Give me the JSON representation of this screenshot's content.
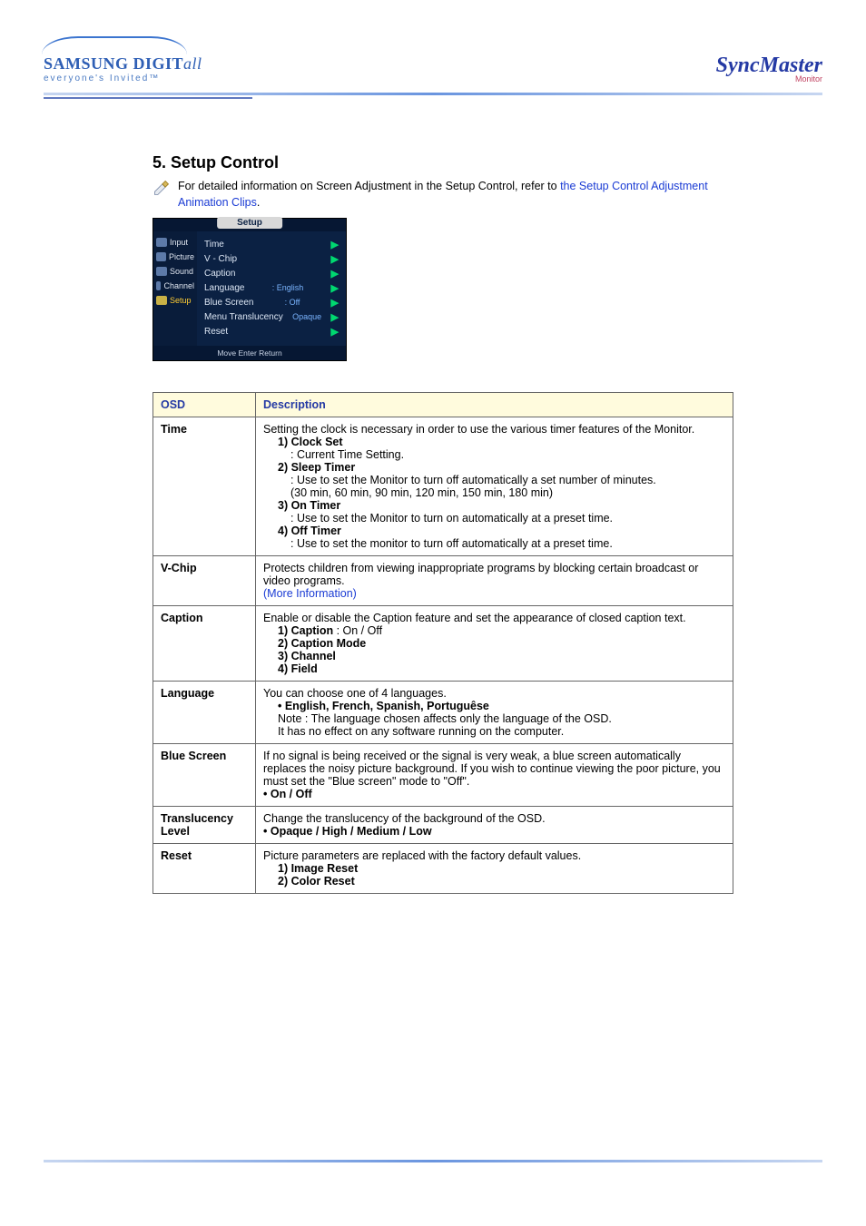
{
  "brand": {
    "left_main_bold": "SAMSUNG DIGIT",
    "left_main_ital": "all",
    "left_tagline": "everyone's Invited™",
    "right_main": "SyncMaster",
    "right_sub": "Monitor"
  },
  "section": {
    "title": "5. Setup Control",
    "info_prefix": "For detailed information on Screen Adjustment in the Setup Control, refer to ",
    "info_link": "the Setup Control Adjustment Animation Clips",
    "info_suffix": "."
  },
  "osd_mock": {
    "title": "Setup",
    "side": [
      "Input",
      "Picture",
      "Sound",
      "Channel",
      "Setup"
    ],
    "side_selected": 4,
    "rows": [
      {
        "label": "Time",
        "val": ""
      },
      {
        "label": "V - Chip",
        "val": ""
      },
      {
        "label": "Caption",
        "val": ""
      },
      {
        "label": "Language",
        "val": ": English"
      },
      {
        "label": "Blue Screen",
        "val": ": Off"
      },
      {
        "label": "Menu Translucency",
        "val": "Opaque"
      },
      {
        "label": "Reset",
        "val": ""
      }
    ],
    "footer": "Move    Enter    Return"
  },
  "table": {
    "headers": [
      "OSD",
      "Description"
    ],
    "rows": {
      "time": {
        "osd": "Time",
        "intro": "Setting the clock is necessary in order to use the various timer features of the Monitor.",
        "l1": "1) Clock Set",
        "l1a": ": Current Time Setting.",
        "l2": "2) Sleep Timer",
        "l2a": ": Use to set the Monitor to turn off automatically a set number of minutes.",
        "l2b": "(30 min, 60 min, 90 min, 120 min, 150 min, 180 min)",
        "l3": "3) On Timer",
        "l3a": ": Use to set the Monitor to turn on automatically at a preset time.",
        "l4": "4) Off Timer",
        "l4a": ": Use to set the monitor to turn off automatically at a preset time."
      },
      "vchip": {
        "osd": "V-Chip",
        "desc": "Protects children from viewing inappropriate programs by blocking certain broadcast or video programs.",
        "link": "(More Information)"
      },
      "caption": {
        "osd": "Caption",
        "intro": "Enable or disable the Caption feature and set the appearance of closed caption text.",
        "l1a": "1) Caption",
        "l1b": " : On / Off",
        "l2": "2) Caption Mode",
        "l3": "3) Channel",
        "l4": "4) Field"
      },
      "language": {
        "osd": "Language",
        "intro": "You can choose one of 4 languages.",
        "l1": "• English, French, Spanish, Portuguêse",
        "note1": "Note : The language chosen affects only the language of the OSD.",
        "note2": "It has no effect on any software running on the computer."
      },
      "bluescreen": {
        "osd": "Blue Screen",
        "desc": "If no signal is being received or the signal is very weak, a blue screen automatically replaces the noisy picture background. If you wish to continue viewing the poor picture, you must set the \"Blue screen\" mode to \"Off\".",
        "opt": "• On / Off"
      },
      "trans": {
        "osd": "Translucency Level",
        "desc": "Change the translucency of the background of the OSD.",
        "opt": "• Opaque / High / Medium / Low"
      },
      "reset": {
        "osd": "Reset",
        "desc": "Picture parameters are replaced with the factory default values.",
        "l1": "1) Image Reset",
        "l2": "2) Color Reset"
      }
    }
  }
}
